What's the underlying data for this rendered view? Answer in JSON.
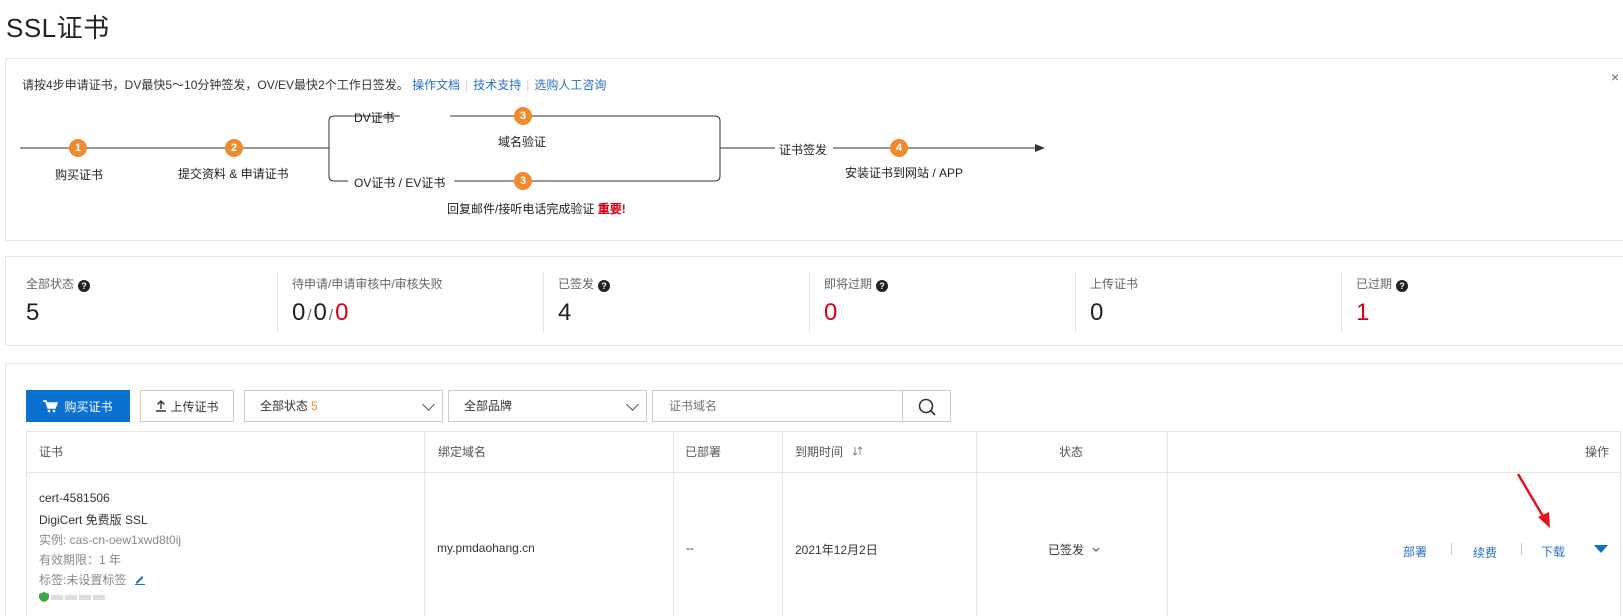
{
  "page_title": "SSL证书",
  "guide": {
    "intro": "请按4步申请证书，DV最快5～10分钟签发，OV/EV最快2个工作日签发。",
    "links": [
      "操作文档",
      "技术支持",
      "选购人工咨询"
    ],
    "close": "×",
    "steps": {
      "s1_num": "1",
      "s1_label": "购买证书",
      "s2_num": "2",
      "s2_label": "提交资料 & 申请证书",
      "dv_label": "DV证书",
      "s3a_num": "3",
      "s3a_label": "域名验证",
      "ovev_label": "OV证书 / EV证书",
      "s3b_num": "3",
      "s3b_label": "回复邮件/接听电话完成验证",
      "s3b_important": "重要!",
      "issue_label": "证书签发",
      "s4_num": "4",
      "s4_label": "安装证书到网站 / APP"
    }
  },
  "stats": [
    {
      "label": "全部状态",
      "value": "5",
      "help": true
    },
    {
      "label": "待申请/申请审核中/审核失败",
      "values": [
        "0",
        "0",
        "0"
      ]
    },
    {
      "label": "已签发",
      "value": "4",
      "help": true
    },
    {
      "label": "即将过期",
      "value": "0",
      "help": true,
      "red": true
    },
    {
      "label": "上传证书",
      "value": "0"
    },
    {
      "label": "已过期",
      "value": "1",
      "help": true,
      "red": true
    }
  ],
  "toolbar": {
    "buy_label": "购买证书",
    "upload_label": "上传证书",
    "status_select": "全部状态",
    "status_count": "5",
    "brand_select": "全部品牌",
    "search_placeholder": "证书域名"
  },
  "table": {
    "headers": {
      "cert": "证书",
      "domain": "绑定域名",
      "deployed": "已部署",
      "expire": "到期时间",
      "status": "状态",
      "actions": "操作"
    },
    "row": {
      "cert_id": "cert-4581506",
      "cert_name": "DigiCert 免费版 SSL",
      "instance": "实例: cas-cn-oew1xwd8t0ij",
      "validity": "有效期限：1 年",
      "tags": "标签:未设置标签",
      "domain": "my.pmdaohang.cn",
      "deployed": "--",
      "expire": "2021年12月2日",
      "status": "已签发",
      "actions": [
        "部署",
        "续费",
        "下载"
      ]
    }
  },
  "colors": {
    "primary": "#0b71d1",
    "step_orange": "#f08a2f",
    "danger": "#d0021b",
    "link": "#2a6fc9"
  }
}
